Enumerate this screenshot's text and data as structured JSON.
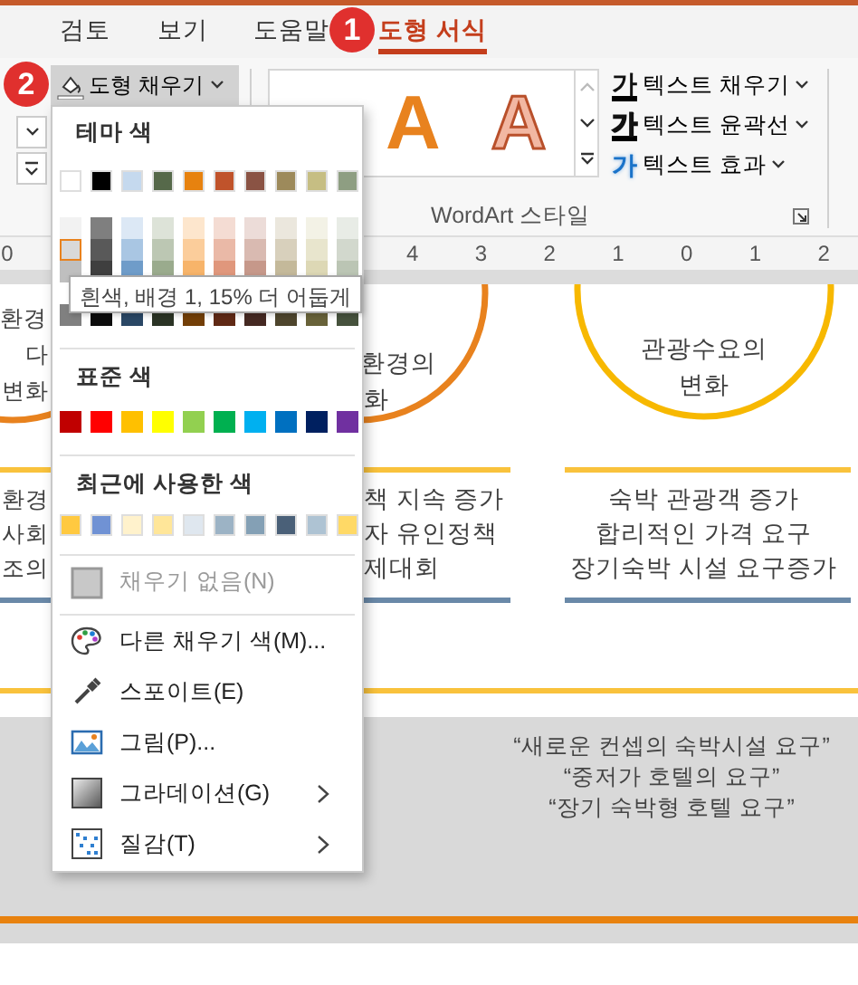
{
  "tabs": [
    {
      "label": "검토",
      "selected": false
    },
    {
      "label": "보기",
      "selected": false
    },
    {
      "label": "도움말",
      "selected": false
    },
    {
      "label": "도형 서식",
      "selected": true
    }
  ],
  "callouts": [
    {
      "number": "1"
    },
    {
      "number": "2"
    }
  ],
  "ribbon": {
    "shape_fill_button": {
      "label": "도형 채우기",
      "expanded": true
    },
    "wordart_gallery": [
      {
        "glyph": "A",
        "kind": "fill"
      },
      {
        "glyph": "A",
        "kind": "outline"
      }
    ],
    "text_commands": [
      {
        "glyph": "가",
        "label": "텍스트 채우기",
        "kind": "fill"
      },
      {
        "glyph": "가",
        "label": "텍스트 윤곽선",
        "kind": "outline"
      },
      {
        "glyph": "가",
        "label": "텍스트 효과",
        "kind": "effect"
      }
    ],
    "group_label": "WordArt 스타일"
  },
  "ruler": {
    "numbers": [
      "0",
      "4",
      "3",
      "2",
      "1",
      "0",
      "1",
      "2"
    ]
  },
  "slide": {
    "columns": [
      {
        "color": "#e8821e",
        "circle_lines": [
          "환경",
          "다",
          "변화"
        ],
        "bullets": [
          "환경",
          "사회",
          "조의"
        ]
      },
      {
        "color": "#e8821e",
        "circle_lines": [
          "환경의",
          "화"
        ],
        "bullets": [
          "책 지속 증가",
          "자 유인정책",
          "제대회"
        ]
      },
      {
        "color": "#f7b800",
        "circle_lines": [
          "관광수요의",
          "변화"
        ],
        "bullets": [
          "숙박 관광객 증가",
          "합리적인 가격 요구",
          "장기숙박 시설 요구증가"
        ]
      }
    ],
    "quotes": [
      "“새로운 컨셉의 숙박시설 요구”",
      "“중저가 호텔의 요구”",
      "“장기 숙박형 호텔 요구”"
    ]
  },
  "fill_menu": {
    "theme_heading": "테마 색",
    "theme_colors": [
      {
        "color": "#ffffff",
        "shades": [
          {
            "color": "#f2f2f2",
            "selected": false
          },
          {
            "color": "#d9d9d9",
            "selected": true
          },
          {
            "color": "#bfbfbf",
            "selected": false
          },
          {
            "color": "#808080",
            "selected": false
          }
        ]
      },
      {
        "color": "#000000",
        "shades": [
          {
            "color": "#7f7f7f",
            "selected": false
          },
          {
            "color": "#595959",
            "selected": false
          },
          {
            "color": "#3f3f3f",
            "selected": false
          },
          {
            "color": "#0d0d0d",
            "selected": false
          }
        ]
      },
      {
        "color": "#c5d9ee",
        "shades": [
          {
            "color": "#dce8f5",
            "selected": false
          },
          {
            "color": "#a9c6e3",
            "selected": false
          },
          {
            "color": "#6f9cc9",
            "selected": false
          },
          {
            "color": "#2a4765",
            "selected": false
          }
        ]
      },
      {
        "color": "#56694a",
        "shades": [
          {
            "color": "#dde3d8",
            "selected": false
          },
          {
            "color": "#bcc7b3",
            "selected": false
          },
          {
            "color": "#9aab8d",
            "selected": false
          },
          {
            "color": "#2b3425",
            "selected": false
          }
        ]
      },
      {
        "color": "#e7820f",
        "shades": [
          {
            "color": "#fde6cd",
            "selected": false
          },
          {
            "color": "#fbcd9b",
            "selected": false
          },
          {
            "color": "#f7b46a",
            "selected": false
          },
          {
            "color": "#733f07",
            "selected": false
          }
        ]
      },
      {
        "color": "#c0532b",
        "shades": [
          {
            "color": "#f4dcd3",
            "selected": false
          },
          {
            "color": "#eab9a7",
            "selected": false
          },
          {
            "color": "#e0977c",
            "selected": false
          },
          {
            "color": "#602915",
            "selected": false
          }
        ]
      },
      {
        "color": "#8a5344",
        "shades": [
          {
            "color": "#ecdcd8",
            "selected": false
          },
          {
            "color": "#d9bab1",
            "selected": false
          },
          {
            "color": "#c6988a",
            "selected": false
          },
          {
            "color": "#452922",
            "selected": false
          }
        ]
      },
      {
        "color": "#9d8a5b",
        "shades": [
          {
            "color": "#ebe7dd",
            "selected": false
          },
          {
            "color": "#d8d0bc",
            "selected": false
          },
          {
            "color": "#c4b99a",
            "selected": false
          },
          {
            "color": "#4e452d",
            "selected": false
          }
        ]
      },
      {
        "color": "#c6be83",
        "shades": [
          {
            "color": "#f3f2e6",
            "selected": false
          },
          {
            "color": "#e8e5cd",
            "selected": false
          },
          {
            "color": "#ddd8b5",
            "selected": false
          },
          {
            "color": "#686239",
            "selected": false
          }
        ]
      },
      {
        "color": "#8e9e82",
        "shades": [
          {
            "color": "#e8ece6",
            "selected": false
          },
          {
            "color": "#d2d8cd",
            "selected": false
          },
          {
            "color": "#bbc5b4",
            "selected": false
          },
          {
            "color": "#46523d",
            "selected": false
          }
        ]
      }
    ],
    "standard_heading": "표준 색",
    "standard_colors": [
      {
        "color": "#c00000"
      },
      {
        "color": "#ff0000"
      },
      {
        "color": "#ffc000"
      },
      {
        "color": "#ffff00"
      },
      {
        "color": "#92d050"
      },
      {
        "color": "#00b050"
      },
      {
        "color": "#00b0f0"
      },
      {
        "color": "#0070c0"
      },
      {
        "color": "#002060"
      },
      {
        "color": "#7030a0"
      }
    ],
    "recent_heading": "최근에 사용한 색",
    "recent_colors": [
      {
        "color": "#ffc940"
      },
      {
        "color": "#7092d4"
      },
      {
        "color": "#fff2cc"
      },
      {
        "color": "#ffe699"
      },
      {
        "color": "#dfe7ef"
      },
      {
        "color": "#9cb3c5"
      },
      {
        "color": "#84a0b5"
      },
      {
        "color": "#4a6078"
      },
      {
        "color": "#aec3d3"
      },
      {
        "color": "#ffd966"
      }
    ],
    "items": [
      {
        "label": "채우기 없음(N)",
        "kind": "nofill",
        "disabled": true,
        "submenu": false
      },
      {
        "label": "다른 채우기 색(M)...",
        "kind": "palette",
        "disabled": false,
        "submenu": false
      },
      {
        "label": "스포이트(E)",
        "kind": "eyedropper",
        "disabled": false,
        "submenu": false
      },
      {
        "label": "그림(P)...",
        "kind": "picture",
        "disabled": false,
        "submenu": false
      },
      {
        "label": "그라데이션(G)",
        "kind": "gradient",
        "disabled": false,
        "submenu": true
      },
      {
        "label": "질감(T)",
        "kind": "texture",
        "disabled": false,
        "submenu": true
      }
    ]
  },
  "tooltip": "흰색, 배경 1, 15% 더 어둡게"
}
